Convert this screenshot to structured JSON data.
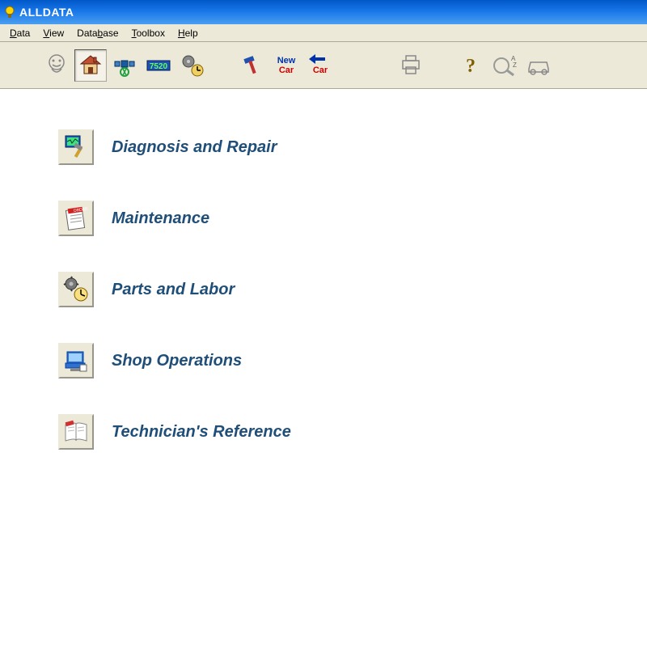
{
  "titlebar": {
    "title": "ALLDATA",
    "app_icon": "alldata-app-icon"
  },
  "menubar": {
    "items": [
      {
        "label": "Data",
        "underline": "D"
      },
      {
        "label": "View",
        "underline": "V"
      },
      {
        "label": "Database",
        "underline": "b"
      },
      {
        "label": "Toolbox",
        "underline": "T"
      },
      {
        "label": "Help",
        "underline": "H"
      }
    ]
  },
  "toolbar": {
    "buttons": [
      {
        "name": "face-icon",
        "active": false
      },
      {
        "name": "home-icon",
        "active": true
      },
      {
        "name": "satellite-icon",
        "active": false
      },
      {
        "name": "code-7520-icon",
        "active": false,
        "text": "7520"
      },
      {
        "name": "gears-clock-icon",
        "active": false
      },
      {
        "gap": "sm"
      },
      {
        "name": "hammer-icon",
        "active": false
      },
      {
        "name": "new-car-icon",
        "active": false,
        "top_text": "New",
        "bottom_text": "Car"
      },
      {
        "name": "back-car-icon",
        "active": false,
        "bottom_text": "Car"
      },
      {
        "gap": "lg"
      },
      {
        "name": "print-icon",
        "active": false
      },
      {
        "gap": "sm"
      },
      {
        "name": "help-icon",
        "active": false
      },
      {
        "name": "az-search-icon",
        "active": false
      },
      {
        "name": "car-icon",
        "active": false
      }
    ]
  },
  "categories": [
    {
      "label": "Diagnosis and Repair",
      "icon": "diagnosis-icon"
    },
    {
      "label": "Maintenance",
      "icon": "maintenance-icon"
    },
    {
      "label": "Parts and Labor",
      "icon": "parts-labor-icon"
    },
    {
      "label": "Shop Operations",
      "icon": "shop-operations-icon"
    },
    {
      "label": "Technician's Reference",
      "icon": "tech-reference-icon"
    }
  ],
  "colors": {
    "titlebar_start": "#0058c8",
    "titlebar_end": "#4a9ff0",
    "chrome_bg": "#ece9d8",
    "link_text": "#1f4e79",
    "accent_red": "#c00000",
    "accent_blue": "#0033aa"
  }
}
